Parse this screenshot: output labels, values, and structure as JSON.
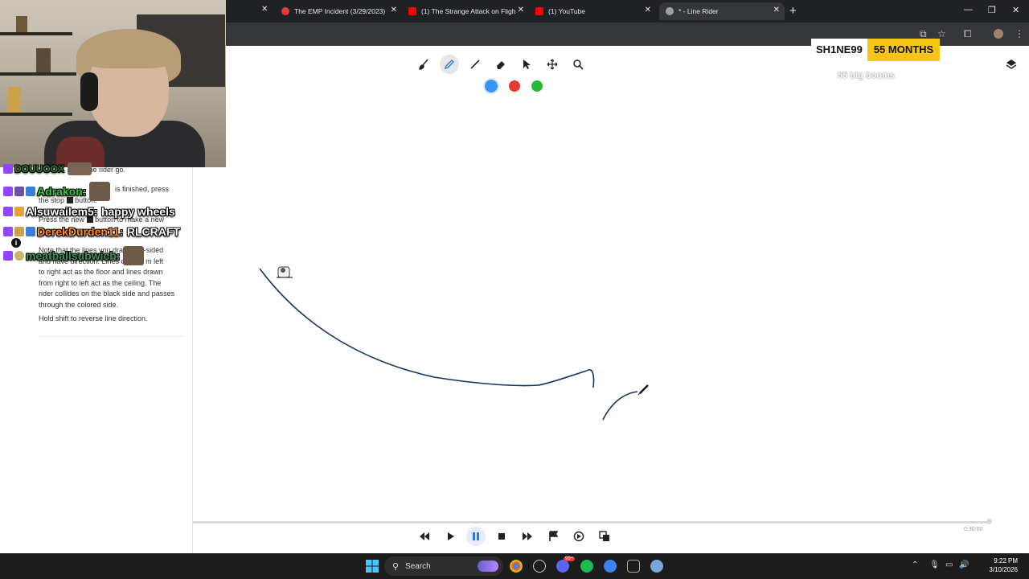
{
  "browser": {
    "tabs": [
      {
        "title": "The EMP Incident (3/29/2023)",
        "favicon_color": "#e53935"
      },
      {
        "title": "(1) The Strange Attack on Fligh",
        "favicon_color": "#ff0000"
      },
      {
        "title": "(1) YouTube",
        "favicon_color": "#ff0000"
      },
      {
        "title": "* - Line Rider",
        "favicon_color": "#9aa0a6"
      }
    ],
    "new_tab": "+"
  },
  "chat": [
    {
      "user": "DOUUOOX",
      "message": "",
      "color": "#2f7d32"
    },
    {
      "user": "Adrakon:",
      "message": "",
      "color": "#35c93a"
    },
    {
      "user": "Alsuwailem5:",
      "message": "happy wheels",
      "color": "#ffffff"
    },
    {
      "user": "DerekDurden11:",
      "message": "RLCRAFT",
      "color": "#ff8c1a"
    },
    {
      "user": "meatballsubwich:",
      "message": "",
      "color": "#3a8f5a"
    }
  ],
  "help": {
    "line1": "the rider go.",
    "line2a": "is finished, press",
    "line2b": "the stop",
    "line2c": "button.",
    "line3a": "Press the new",
    "line3b": "button to make a new",
    "line4a": "Note that the lines you draw",
    "line4b": "e-sided",
    "line5a": "and have direction. Lines drawn",
    "line5b": "m left",
    "rest": [
      "to right act as the floor and lines drawn",
      "from right to left act as the ceiling. The",
      "rider collides on the black side and passes",
      "through the colored side."
    ],
    "shift": "Hold shift to reverse line direction."
  },
  "toolbar": {
    "tools": [
      "brush-icon",
      "pencil-icon",
      "line-icon",
      "eraser-icon",
      "pointer-icon",
      "pan-icon",
      "zoom-icon"
    ],
    "active_tool": "pencil-icon",
    "colors": [
      "#3995f5",
      "#e53935",
      "#22bb33"
    ]
  },
  "sub_alert": {
    "name": "SH1NE99",
    "months": "55 MONTHS",
    "note": "55 big booms"
  },
  "playback": {
    "timecode": "0:30:00",
    "buttons": [
      "rewind-icon",
      "play-icon",
      "pause-icon",
      "stop-icon",
      "fast-forward-icon",
      "flag-icon",
      "speed-icon",
      "onion-skin-icon"
    ],
    "active_button": "pause-icon"
  },
  "taskbar": {
    "search_label": "Search",
    "time": "9:22 PM",
    "date": "3/10/2026",
    "badge_count": "99+"
  }
}
